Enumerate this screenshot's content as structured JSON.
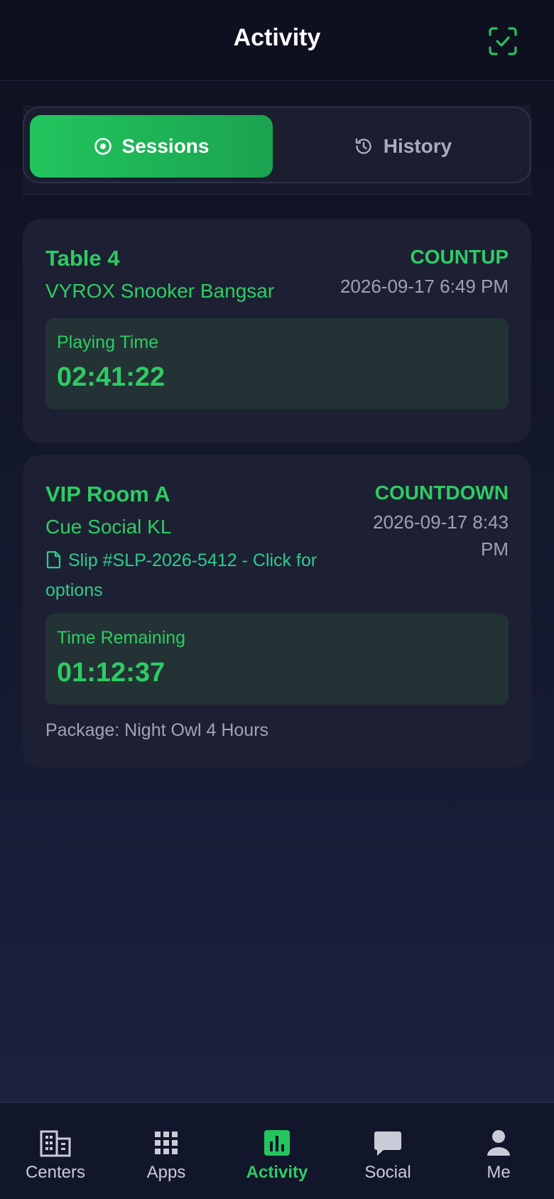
{
  "header": {
    "title": "Activity",
    "scan_icon": "scan-check-icon",
    "accent_color": "#22c55e"
  },
  "tabs": [
    {
      "label": "Sessions",
      "icon": "radio-target-icon",
      "active": true
    },
    {
      "label": "History",
      "icon": "history-icon",
      "active": false
    }
  ],
  "sessions": [
    {
      "title": "Table 4",
      "venue": "VYROX Snooker Bangsar",
      "mode": "COUNTUP",
      "datetime": "2026-09-17 6:49 PM",
      "timer_label": "Playing Time",
      "timer_value": "02:41:22"
    },
    {
      "title": "VIP Room A",
      "venue": "Cue Social KL",
      "mode": "COUNTDOWN",
      "datetime_line1": "2026-09-17 8:43",
      "datetime_line2": "PM",
      "slip_line1": "Slip #SLP-2026-5412 - Click for",
      "slip_line2": "options",
      "timer_label": "Time Remaining",
      "timer_value": "01:12:37",
      "package": "Package: Night Owl 4 Hours"
    }
  ],
  "bottom_nav": [
    {
      "label": "Centers",
      "icon": "building-icon",
      "active": false
    },
    {
      "label": "Apps",
      "icon": "grid-icon",
      "active": false
    },
    {
      "label": "Activity",
      "icon": "bar-chart-icon",
      "active": true
    },
    {
      "label": "Social",
      "icon": "chat-bubble-icon",
      "active": false
    },
    {
      "label": "Me",
      "icon": "person-icon",
      "active": false
    }
  ]
}
